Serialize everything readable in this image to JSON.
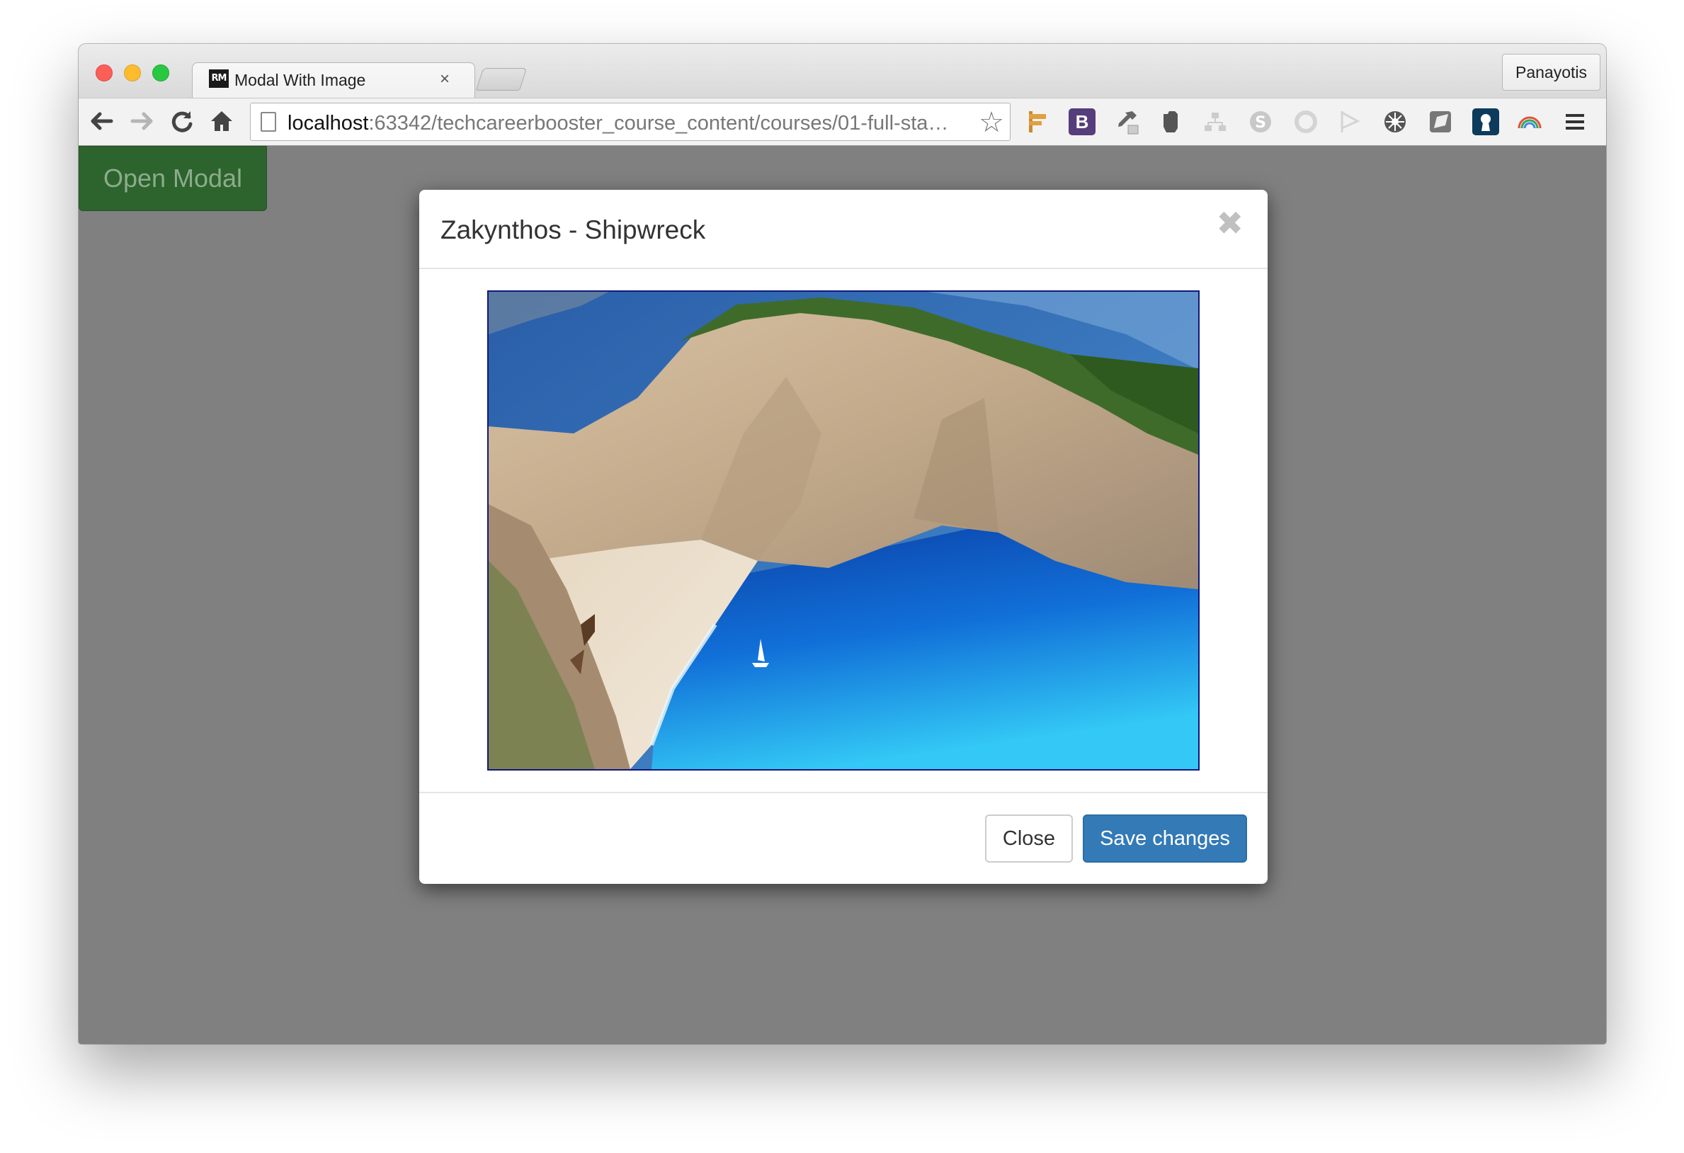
{
  "browser": {
    "tab_title": "Modal With Image",
    "tab_favicon": "RM",
    "tab_close": "×",
    "profile_name": "Panayotis",
    "url_host": "localhost",
    "url_rest": ":63342/techcareerbooster_course_content/courses/01-full-sta…",
    "nav_icons": [
      "back-arrow-icon",
      "forward-arrow-icon",
      "reload-icon",
      "home-icon"
    ],
    "extension_icons": [
      "bookmark-sign-icon",
      "bootstrap-icon",
      "eyedropper-icon",
      "evernote-icon",
      "sitemap-icon",
      "skype-icon",
      "sync-icon",
      "flag-icon",
      "settings-wheel-icon",
      "screenshot-icon",
      "keyhole-icon",
      "rainbow-icon",
      "menu-icon"
    ]
  },
  "page": {
    "open_modal_label": "Open Modal"
  },
  "modal": {
    "title": "Zakynthos - Shipwreck",
    "close_glyph": "✖",
    "close_button": "Close",
    "save_button": "Save changes",
    "image_subject": "aerial-photo-navagio-beach"
  },
  "colors": {
    "open_button_bg": "#2d632d",
    "save_button_bg": "#337ab7",
    "overlay": "#808080"
  }
}
